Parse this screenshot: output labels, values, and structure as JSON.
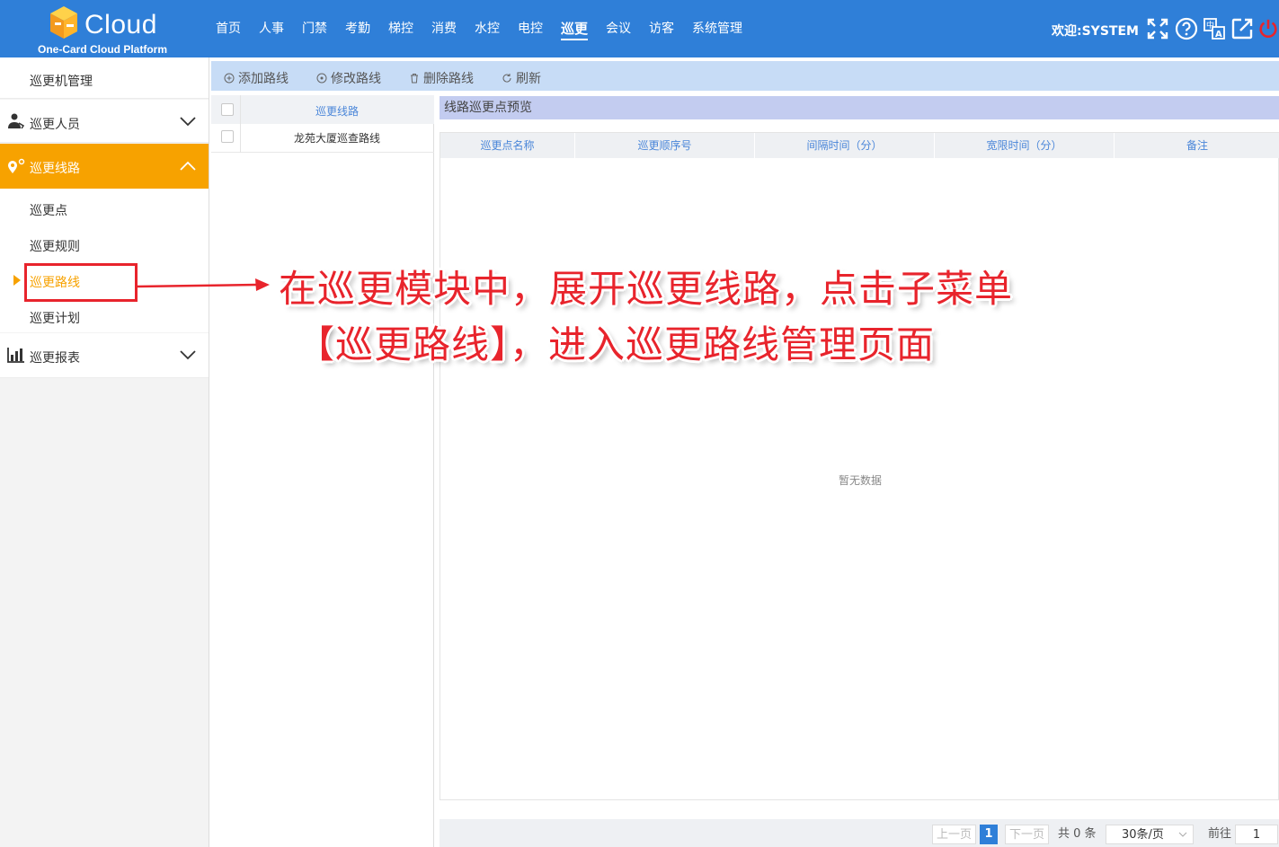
{
  "header": {
    "brand": "Cloud",
    "subtitle": "One-Card Cloud Platform",
    "nav": [
      "首页",
      "人事",
      "门禁",
      "考勤",
      "梯控",
      "消费",
      "水控",
      "电控",
      "巡更",
      "会议",
      "访客",
      "系统管理"
    ],
    "active_nav": "巡更",
    "welcome": "欢迎:SYSTEM"
  },
  "sidebar": {
    "machine_mgmt": "巡更机管理",
    "personnel": "巡更人员",
    "route_group": "巡更线路",
    "sub_items": [
      "巡更点",
      "巡更规则",
      "巡更路线",
      "巡更计划"
    ],
    "selected_sub": "巡更路线",
    "report": "巡更报表"
  },
  "toolbar": {
    "add": "添加路线",
    "edit": "修改路线",
    "delete": "删除路线",
    "refresh": "刷新"
  },
  "route_table": {
    "header": "巡更线路",
    "rows": [
      "龙苑大厦巡查路线"
    ]
  },
  "preview": {
    "title": "线路巡更点预览",
    "columns": [
      "巡更点名称",
      "巡更顺序号",
      "间隔时间（分）",
      "宽限时间（分）",
      "备注"
    ],
    "empty_text": "暂无数据"
  },
  "pagination": {
    "prev": "上一页",
    "current": "1",
    "next": "下一页",
    "total": "共 0 条",
    "page_size": "30条/页",
    "goto_label": "前往",
    "goto_value": "1"
  },
  "annotation": {
    "line1": "在巡更模块中，展开巡更线路，点击子菜单",
    "line2": "【巡更路线】，进入巡更路线管理页面"
  },
  "colors": {
    "header_blue": "#2f7fd8",
    "active_orange": "#f7a200",
    "annotation_red": "#e8242c"
  }
}
